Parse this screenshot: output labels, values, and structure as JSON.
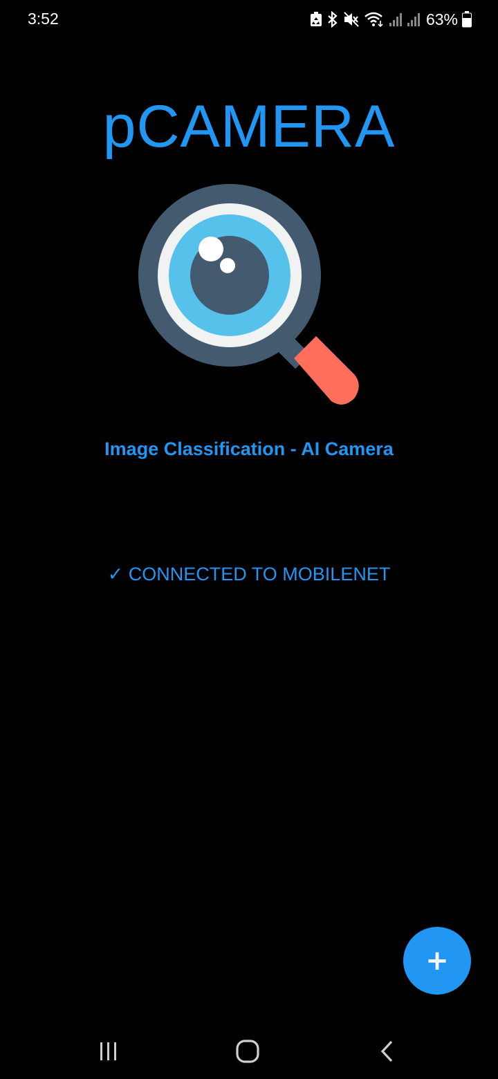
{
  "status_bar": {
    "time": "3:52",
    "battery_percent": "63%",
    "icons": [
      "recycle-notification-icon",
      "bluetooth-icon",
      "mute-icon",
      "wifi-icon",
      "signal-icon",
      "signal-icon",
      "battery-icon"
    ]
  },
  "app": {
    "title": "pCAMERA",
    "subtitle": "Image Classification - AI Camera",
    "connection_status": "✓ CONNECTED TO MOBILENET",
    "logo_icon": "magnifying-glass-eye-icon"
  },
  "fab": {
    "label": "+",
    "icon": "add-icon"
  },
  "nav_bar": {
    "buttons": [
      "recents",
      "home",
      "back"
    ]
  },
  "colors": {
    "accent": "#2196F3",
    "background": "#000000",
    "logo_ring": "#445A6E",
    "logo_iris": "#56C1EA",
    "logo_handle": "#FF6F5B"
  }
}
